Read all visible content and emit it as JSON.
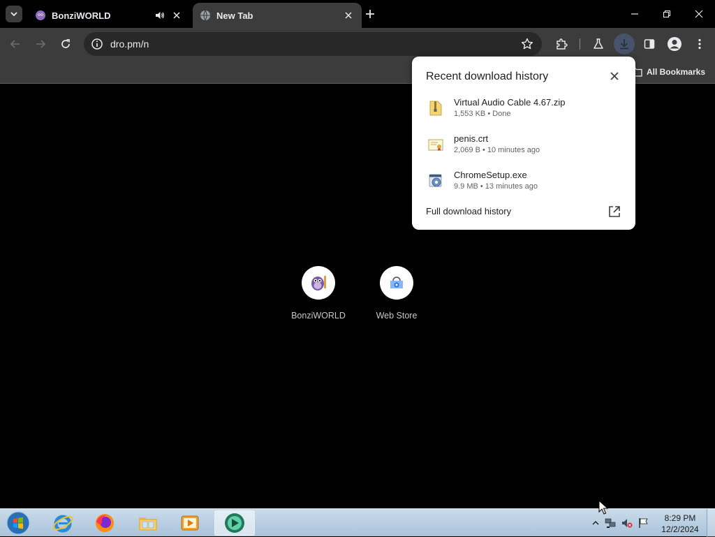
{
  "tabs": [
    {
      "title": "BonziWORLD",
      "active": false,
      "audio": true
    },
    {
      "title": "New Tab",
      "active": true,
      "audio": false
    }
  ],
  "omnibox": {
    "url": "dro.pm/n"
  },
  "bookmarks": {
    "all_label": "All Bookmarks"
  },
  "shortcuts": [
    {
      "label": "BonziWORLD",
      "icon": "bonzi-icon"
    },
    {
      "label": "Web Store",
      "icon": "web-store-icon"
    }
  ],
  "downloads": {
    "heading": "Recent download history",
    "items": [
      {
        "name": "Virtual Audio Cable 4.67.zip",
        "status": "1,553 KB • Done",
        "icon": "zip-file-icon"
      },
      {
        "name": "penis.crt",
        "status": "2,069 B • 10 minutes ago",
        "icon": "certificate-file-icon"
      },
      {
        "name": "ChromeSetup.exe",
        "status": "9.9 MB • 13 minutes ago",
        "icon": "exe-file-icon"
      }
    ],
    "full_history_label": "Full download history"
  },
  "taskbar": {
    "apps": [
      "internet-explorer-icon",
      "firefox-icon",
      "file-explorer-icon",
      "media-player-icon",
      "bonzi-browser-icon"
    ],
    "time": "8:29 PM",
    "date": "12/2/2024"
  },
  "colors": {
    "toolbar": "#3c3c3c",
    "bubble": "#ffffff",
    "accent": "#47536a"
  }
}
